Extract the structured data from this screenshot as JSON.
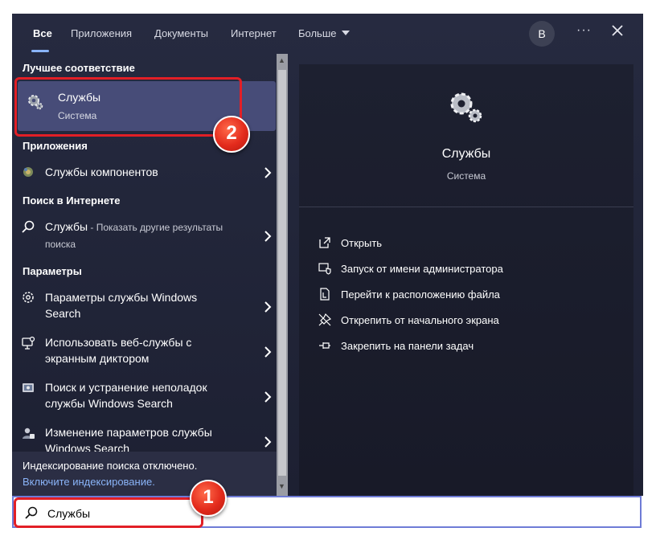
{
  "nav": {
    "tabs": [
      "Все",
      "Приложения",
      "Документы",
      "Интернет",
      "Больше"
    ],
    "avatar": "В"
  },
  "sections": {
    "best": "Лучшее соответствие",
    "apps": "Приложения",
    "web": "Поиск в Интернете",
    "settings": "Параметры"
  },
  "best_match": {
    "title": "Службы",
    "subtitle": "Система"
  },
  "apps": [
    {
      "label": "Службы компонентов"
    }
  ],
  "web": {
    "label": "Службы",
    "dim": " - Показать другие результаты",
    "line2": "поиска"
  },
  "settings": [
    {
      "line1": "Параметры службы Windows",
      "line2": "Search"
    },
    {
      "line1": "Использовать веб-службы с",
      "line2": "экранным диктором"
    },
    {
      "line1": "Поиск и устранение неполадок",
      "line2": "службы Windows Search"
    },
    {
      "line1": "Изменение параметров службы",
      "line2": "Windows Search"
    }
  ],
  "status": {
    "text": "Индексирование поиска отключено.",
    "link": "Включите индексирование."
  },
  "preview": {
    "title": "Службы",
    "subtitle": "Система",
    "actions": [
      "Открыть",
      "Запуск от имени администратора",
      "Перейти к расположению файла",
      "Открепить от начального экрана",
      "Закрепить на панели задач"
    ]
  },
  "search": {
    "value": "Службы"
  },
  "annotations": {
    "badge1": "1",
    "badge2": "2"
  },
  "colors": {
    "accent": "#8ab4f8",
    "highlight": "#e21f26",
    "selected": "#474c78"
  }
}
